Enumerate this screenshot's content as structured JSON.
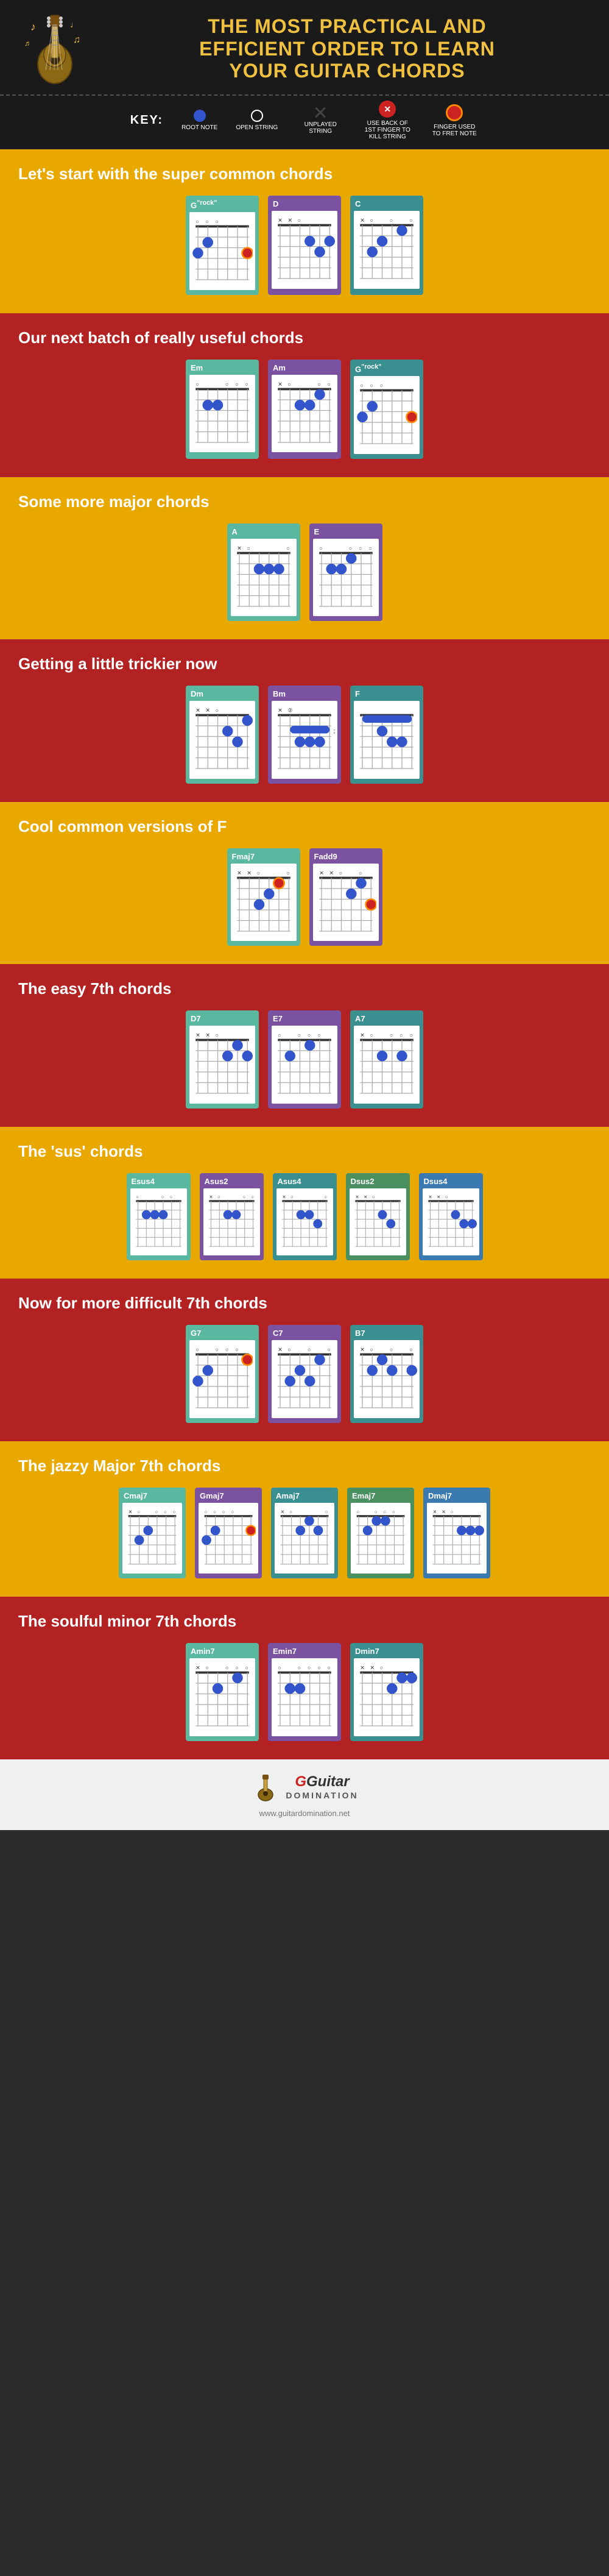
{
  "header": {
    "title_line1": "THE MOST PRACTICAL AND",
    "title_line2": "EFFICIENT ORDER TO LEARN",
    "title_line3": "YOUR GUITAR CHORDS"
  },
  "key": {
    "label": "KEY:",
    "items": [
      {
        "id": "root-note",
        "type": "filled-circle",
        "text": "ROOT NOTE"
      },
      {
        "id": "open-string",
        "type": "open-circle",
        "text": "OPEN STRING"
      },
      {
        "id": "unplayed-string",
        "type": "x",
        "text": "UNPLAYED STRING"
      },
      {
        "id": "kill-string",
        "type": "kill",
        "text": "USE BACK OF 1ST FINGER TO KILL STRING"
      },
      {
        "id": "fret-note",
        "type": "fret",
        "text": "FINGER USED TO FRET NOTE"
      }
    ]
  },
  "sections": [
    {
      "id": "super-common",
      "bg": "yellow",
      "title": "Let's start with the super common chords",
      "chords": [
        "G\"rock\"",
        "D",
        "C"
      ]
    },
    {
      "id": "really-useful",
      "bg": "red",
      "title": "Our next batch of really useful chords",
      "chords": [
        "Em",
        "Am",
        "G\"rock\""
      ]
    },
    {
      "id": "more-major",
      "bg": "yellow",
      "title": "Some more major chords",
      "chords": [
        "A",
        "E"
      ]
    },
    {
      "id": "trickier",
      "bg": "red",
      "title": "Getting a little trickier now",
      "chords": [
        "Dm",
        "Bm",
        "F"
      ]
    },
    {
      "id": "versions-f",
      "bg": "yellow",
      "title": "Cool common versions of F",
      "chords": [
        "Fmaj7",
        "Fadd9"
      ]
    },
    {
      "id": "easy-7th",
      "bg": "red",
      "title": "The easy 7th chords",
      "chords": [
        "D7",
        "E7",
        "A7"
      ]
    },
    {
      "id": "sus-chords",
      "bg": "yellow",
      "title": "The 'sus' chords",
      "chords": [
        "Esus4",
        "Asus2",
        "Asus4",
        "Dsus2",
        "Dsus4"
      ]
    },
    {
      "id": "difficult-7th",
      "bg": "red",
      "title": "Now for more difficult 7th chords",
      "chords": [
        "G7",
        "C7",
        "B7"
      ]
    },
    {
      "id": "jazzy-major-7th",
      "bg": "yellow",
      "title": "The jazzy Major 7th chords",
      "chords": [
        "Cmaj7",
        "Gmaj7",
        "Amaj7",
        "Emaj7",
        "Dmaj7"
      ]
    },
    {
      "id": "soulful-minor-7th",
      "bg": "red",
      "title": "The soulful minor 7th chords",
      "chords": [
        "Amin7",
        "Emin7",
        "Dmin7"
      ]
    }
  ],
  "footer": {
    "logo_text": "Guitar",
    "logo_sub": "Domination",
    "url": "www.guitardomination.net"
  }
}
